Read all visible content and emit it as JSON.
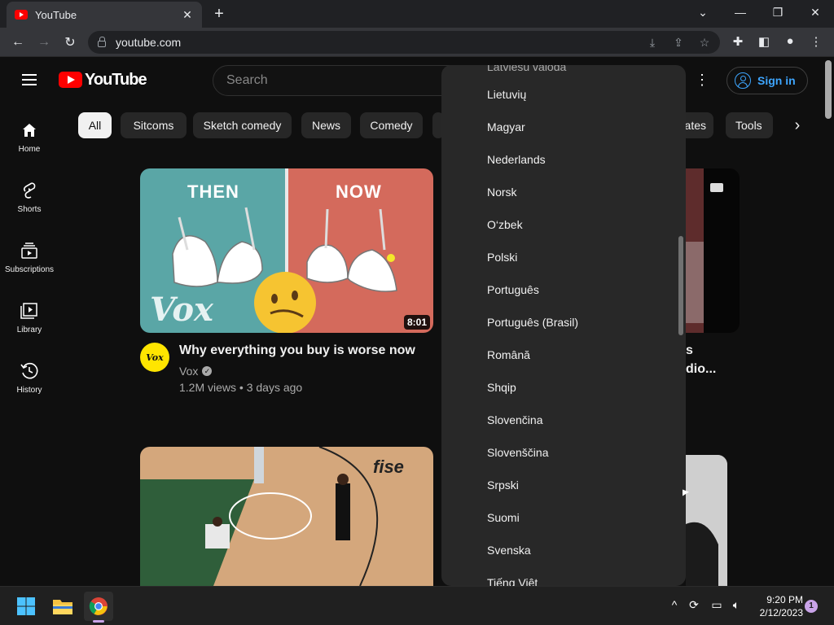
{
  "browser": {
    "tab_title": "YouTube",
    "tab_close": "✕",
    "new_tab": "+",
    "url": "youtube.com"
  },
  "header": {
    "logo_text": "YouTube",
    "search_placeholder": "Search",
    "signin_label": "Sign in"
  },
  "chips": [
    "All",
    "Sitcoms",
    "Sketch comedy",
    "News",
    "Comedy",
    "ates",
    "Tools"
  ],
  "rail": [
    {
      "label": "Home",
      "icon": "home-icon"
    },
    {
      "label": "Shorts",
      "icon": "shorts-icon"
    },
    {
      "label": "Subscriptions",
      "icon": "subscriptions-icon"
    },
    {
      "label": "Library",
      "icon": "library-icon"
    },
    {
      "label": "History",
      "icon": "history-icon"
    }
  ],
  "videos": [
    {
      "thumb_left_label": "THEN",
      "thumb_right_label": "NOW",
      "thumb_watermark": "Vox",
      "duration": "8:01",
      "avatar_text": "Vox",
      "title": "Why everything you buy is worse now",
      "channel": "Vox",
      "meta": "1.2M views • 3 days ago"
    }
  ],
  "partial_video": {
    "line1": "s",
    "line2": "dio..."
  },
  "language_menu": {
    "top_partial": "Latviešu valoda",
    "items": [
      "Lietuvių",
      "Magyar",
      "Nederlands",
      "Norsk",
      "O‘zbek",
      "Polski",
      "Português",
      "Português (Brasil)",
      "Română",
      "Shqip",
      "Slovenčina",
      "Slovenščina",
      "Srpski",
      "Suomi",
      "Svenska",
      "Tiếng Việt"
    ]
  },
  "taskbar": {
    "time": "9:20 PM",
    "date": "2/12/2023",
    "notification_count": "1"
  },
  "colors": {
    "yt_red": "#ff0000",
    "link_blue": "#3ea6ff",
    "menu_bg": "#282828",
    "page_bg": "#0f0f0f"
  }
}
